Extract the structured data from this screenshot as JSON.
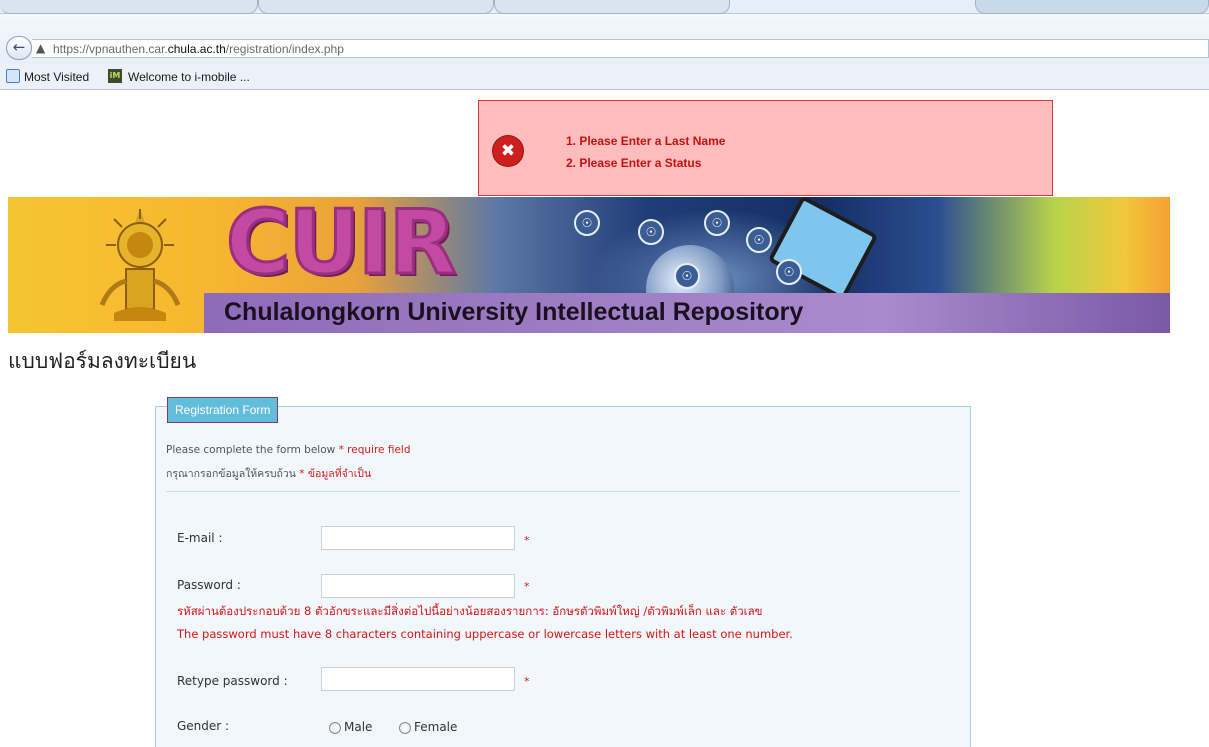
{
  "browser": {
    "url_prefix": "https://vpnauthen.car.",
    "url_domain": "chula.ac.th",
    "url_path": "/registration/index.php",
    "back_glyph": "←",
    "warning_glyph": "▲",
    "bookmarks": [
      {
        "label": "Most Visited",
        "icon": "most-visited-icon"
      },
      {
        "label": "Welcome to i-mobile ...",
        "icon": "i-mobile-icon"
      }
    ]
  },
  "errors": {
    "icon": "error-x-icon",
    "icon_glyph": "✖",
    "items": [
      "1. Please Enter a Last Name",
      "2. Please Enter a Status"
    ],
    "colors": {
      "background": "#ffbdbd",
      "text": "#c81010",
      "icon": "#cc1f1f"
    }
  },
  "banner": {
    "logo_text": "CUIR",
    "subtitle": "Chulalongkorn University Intellectual Repository",
    "node_glyph": "☉"
  },
  "page": {
    "title": "แบบฟอร์มลงทะเบียน"
  },
  "form": {
    "legend": "Registration Form",
    "intro_en": "Please complete the form below",
    "intro_en_req": "* require field",
    "intro_th": "กรุณากรอกข้อมูลให้ครบถ้วน",
    "intro_th_req": "* ข้อมูลที่จำเป็น",
    "required_mark": "*",
    "fields": {
      "email": {
        "label": "E-mail :",
        "value": ""
      },
      "password": {
        "label": "Password :",
        "value": ""
      },
      "retype": {
        "label": "Retype password :",
        "value": ""
      },
      "gender": {
        "label": "Gender :",
        "options": [
          "Male",
          "Female"
        ]
      }
    },
    "password_hint_th": "รหัสผ่านต้องประกอบด้วย 8 ตัวอักขระและมีสิ่งต่อไปนี้อย่างน้อยสองรายการ: อักษรตัวพิมพ์ใหญ่ /ตัวพิมพ์เล็ก และ ตัวเลข",
    "password_hint_en": "The password must have 8 characters containing uppercase or lowercase letters with at least one number.",
    "colors": {
      "legend": "#62bddb",
      "panel": "#f1f7fb",
      "required": "#d02020"
    }
  }
}
